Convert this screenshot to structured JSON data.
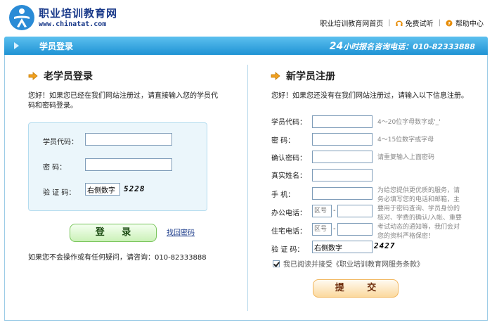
{
  "header": {
    "site_name": "职业培训教育网",
    "site_url": "www.chinatat.com",
    "links": {
      "home": "职业培训教育网首页",
      "free_trial": "免费试听",
      "help": "帮助中心"
    }
  },
  "navbar": {
    "title": "学员登录",
    "hotline_prefix": "24",
    "hotline_text": "小时报名咨询电话：010-82333888"
  },
  "login": {
    "title": "老学员登录",
    "intro": "您好！如果您已经在我们网站注册过，请直接输入您的学员代码和密码登录。",
    "fields": {
      "student_code_label": "学员代码：",
      "password_label": "密    码：",
      "captcha_label": "验 证 码：",
      "captcha_value": "右侧数字",
      "captcha_code": "5228"
    },
    "login_button": "登    录",
    "recover_link": "找回密码",
    "help_text": "如果您不会操作或有任何疑问，请咨询：010-82333888"
  },
  "register": {
    "title": "新学员注册",
    "intro": "您好！如果您还没有在我们网站注册过，请输入以下信息注册。",
    "fields": {
      "student_code_label": "学员代码：",
      "student_code_hint": "4～20位字母数字或'_'",
      "password_label": "密    码：",
      "password_hint": "4～15位数字或字母",
      "confirm_label": "确认密码：",
      "confirm_hint": "请重复输入上面密码",
      "realname_label": "真实姓名：",
      "mobile_label": "手    机：",
      "office_phone_label": "办公电话：",
      "home_phone_label": "住宅电话：",
      "area_placeholder": "区号",
      "captcha_label": "验 证 码：",
      "captcha_value": "右侧数字",
      "captcha_code": "2427"
    },
    "notice": "为给您提供更优质的服务，请务必填写您的电话和邮箱，主要用于密码查询、学员身份的核对、学费的确认/入帐、重要考试动态的通知等，我们会对您的资料严格保密！",
    "agree_text": "我已阅读并接受《职业培训教育网服务条款》",
    "agree_checked": true,
    "submit_button": "提    交"
  },
  "colors": {
    "navbar": "#2ba3df",
    "login_button": "#cbf1b8",
    "submit_button": "#fbd99e",
    "brand": "#1a3a8a"
  }
}
